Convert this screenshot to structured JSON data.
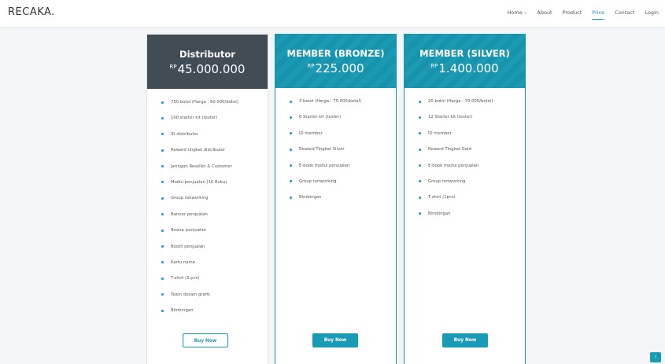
{
  "navbar": {
    "brand": "RECAKA.",
    "items": [
      {
        "label": "Home",
        "dropdown": true
      },
      {
        "label": "About"
      },
      {
        "label": "Product"
      },
      {
        "label": "Price",
        "active": true
      },
      {
        "label": "Contact"
      },
      {
        "label": "Login"
      }
    ]
  },
  "plans": [
    {
      "title": "Distributor",
      "currency": "RP",
      "price": "45.000.000",
      "features": [
        "750 botol (Harga : 60.000/botol)",
        "100 starter kit (tester)",
        "ID distributor",
        "Reward tingkat distributor",
        "Jaringan Reseller & Customer",
        "Modul penjualan (10 Buku)",
        "Group networking",
        "Banner penjualan",
        "Brosur penjualan",
        "Booth penjualan",
        "Kartu nama",
        "T-shirt (5 pcs)",
        "Team desain grafis",
        "Bimbingan"
      ],
      "button": "Buy Now"
    },
    {
      "title": "MEMBER (BRONZE)",
      "currency": "RP",
      "price": "225.000",
      "features": [
        "3 botol (Harga : 75.000/botol)",
        "6 Starter kit (tester)",
        "ID member",
        "Reward Tingkat Silver",
        "E-book modul penjualan",
        "Group networking",
        "Bimbingan"
      ],
      "button": "Buy Now"
    },
    {
      "title": "MEMBER (SILVER)",
      "currency": "RP",
      "price": "1.400.000",
      "features": [
        "20 botol (Harga : 70.000/botol)",
        "12 Starter kit (tester)",
        "ID member",
        "Reward Tingkat Gold",
        "E-book modul penjualan",
        "Group networking",
        "T-shirt (1pcs)",
        "Bimbingan"
      ],
      "button": "Buy Now"
    }
  ],
  "back_to_top": "↑",
  "colors": {
    "accent": "#1a9bb5",
    "dark_header": "#424c55",
    "background": "#f3f5f7"
  }
}
